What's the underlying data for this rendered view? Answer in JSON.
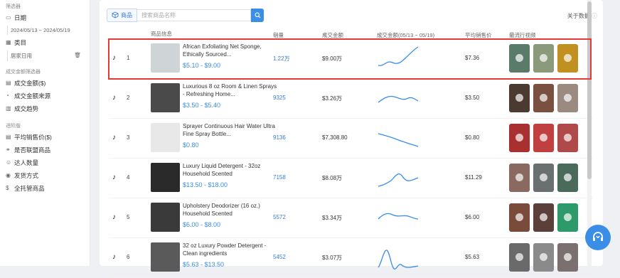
{
  "sidebar": {
    "section1": "筛选器",
    "date_label": "日期",
    "date_range": "2024/05/13 ~ 2024/05/19",
    "category_label": "类目",
    "category_value": "居家日用",
    "section2": "成交金额筛选器",
    "items2": [
      "成交金额($)",
      "成交金额来源",
      "成交趋势"
    ],
    "section3": "进阶版",
    "items3": [
      "平均销售价($)",
      "是否联盟商品",
      "达人数量",
      "发货方式",
      "全托管商品"
    ]
  },
  "toolbar": {
    "tab_label": "商品",
    "search_placeholder": "搜索商品名称",
    "about_label": "关于数据"
  },
  "table": {
    "headers": {
      "info": "商品信息",
      "sales": "销量",
      "amount": "成交金额",
      "trend": "成交金额(05/13 ~ 05/19)",
      "avg": "平均销售价",
      "videos": "最流行视频"
    },
    "rows": [
      {
        "rank": "1",
        "name": "African Exfoliating Net Sponge, Ethically Sourced...",
        "price": "$5.10 - $9.00",
        "sales": "1.22万",
        "amount": "$9.00万",
        "avg": "$7.36"
      },
      {
        "rank": "2",
        "name": "Luxurious 8 oz Room & Linen Sprays - Refreshing Home...",
        "price": "$3.50 - $5.40",
        "sales": "9325",
        "amount": "$3.26万",
        "avg": "$3.50"
      },
      {
        "rank": "3",
        "name": "Sprayer Continuous Hair Water Ultra Fine Spray Bottle...",
        "price": "$0.80",
        "sales": "9136",
        "amount": "$7,308.80",
        "avg": "$0.80"
      },
      {
        "rank": "4",
        "name": "Luxury Liquid Detergent - 32oz Household Scented",
        "price": "$13.50 - $18.00",
        "sales": "7158",
        "amount": "$8.08万",
        "avg": "$11.29"
      },
      {
        "rank": "5",
        "name": "Upholstery Deodorizer (16 oz.) Household Scented",
        "price": "$6.00 - $8.00",
        "sales": "5572",
        "amount": "$3.34万",
        "avg": "$6.00"
      },
      {
        "rank": "6",
        "name": "32 oz Luxury Powder Detergent - Clean ingredients",
        "price": "$5.63 - $13.50",
        "sales": "5452",
        "amount": "$3.07万",
        "avg": "$5.63"
      }
    ]
  },
  "colors": {
    "accent": "#3a8ee6",
    "highlight": "#e53935"
  }
}
